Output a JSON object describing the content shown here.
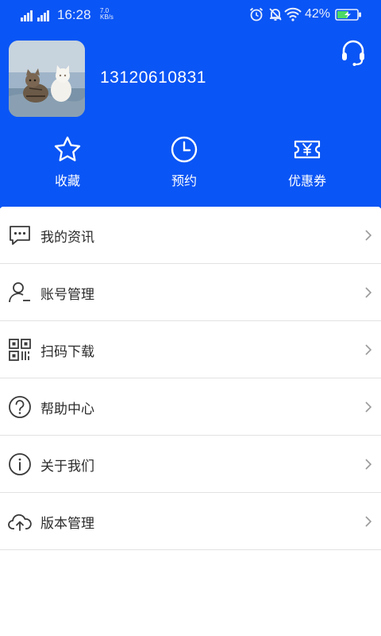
{
  "status_bar": {
    "time": "16:28",
    "speed_value": "7.0",
    "speed_unit": "KB/s",
    "battery": "42%"
  },
  "profile": {
    "phone": "13120610831",
    "avatar": "cat-photo"
  },
  "quick_actions": [
    {
      "label": "收藏",
      "icon": "star-icon"
    },
    {
      "label": "预约",
      "icon": "clock-icon"
    },
    {
      "label": "优惠券",
      "icon": "coupon-icon"
    }
  ],
  "menu": [
    {
      "label": "我的资讯",
      "icon": "message-icon"
    },
    {
      "label": "账号管理",
      "icon": "account-icon"
    },
    {
      "label": "扫码下载",
      "icon": "qr-code-icon"
    },
    {
      "label": "帮助中心",
      "icon": "help-icon"
    },
    {
      "label": "关于我们",
      "icon": "info-icon"
    },
    {
      "label": "版本管理",
      "icon": "cloud-upload-icon"
    }
  ],
  "colors": {
    "header": "#0a55f5",
    "menu_text": "#2b2b2b",
    "divider": "#e2e2e2"
  }
}
